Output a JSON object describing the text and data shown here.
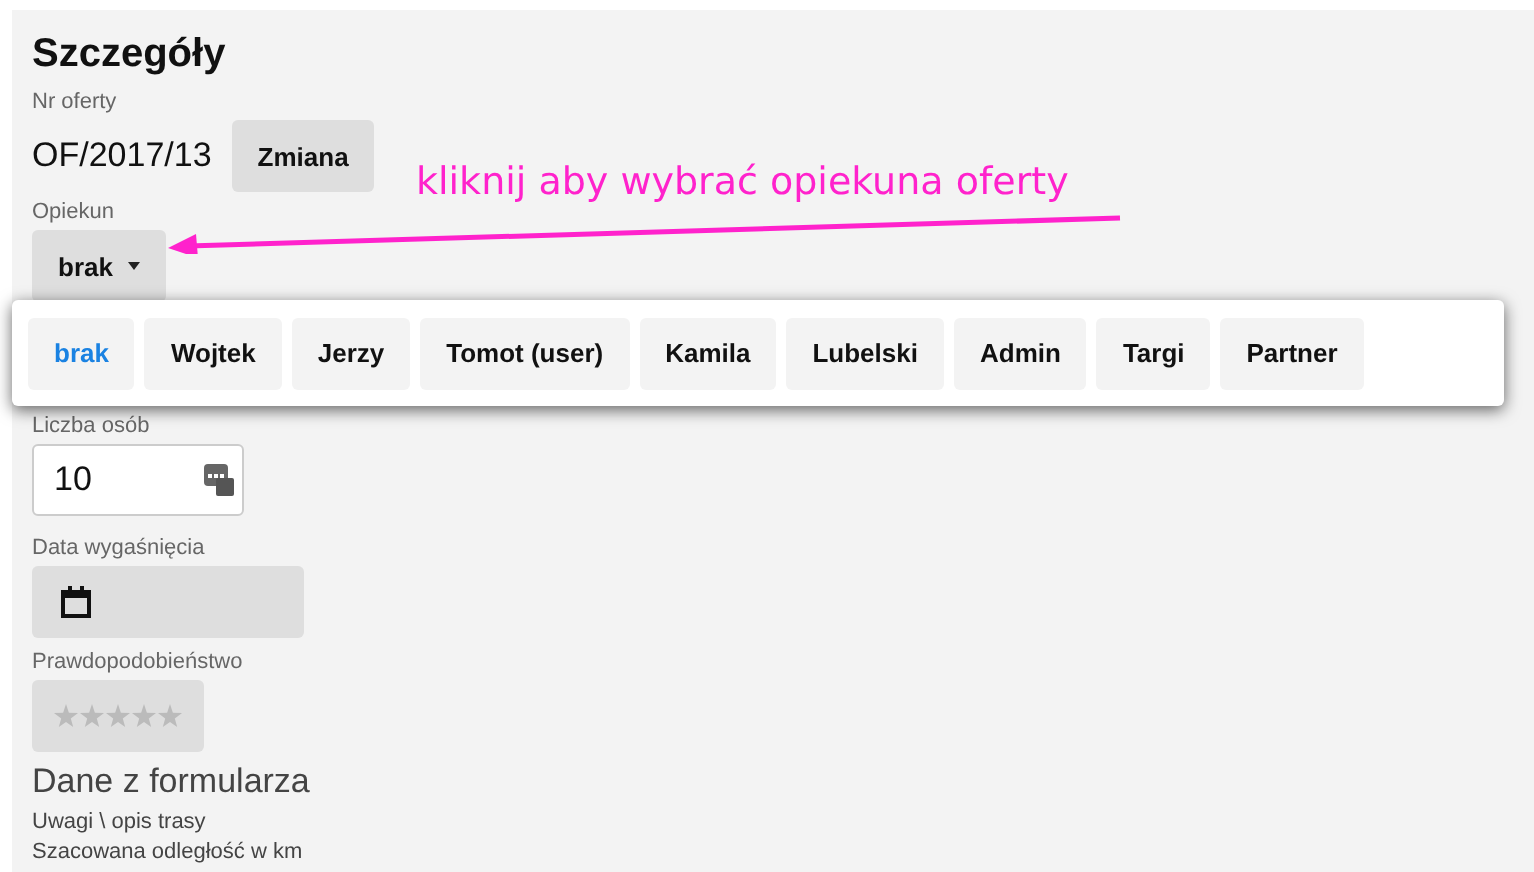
{
  "title": "Szczegóły",
  "offer": {
    "label": "Nr oferty",
    "number": "OF/2017/13",
    "button": "Zmiana"
  },
  "owner": {
    "label": "Opiekun",
    "value": "brak",
    "annotation": "kliknij aby wybrać opiekuna oferty"
  },
  "owner_options": [
    {
      "label": "brak",
      "selected": true
    },
    {
      "label": "Wojtek",
      "selected": false
    },
    {
      "label": "Jerzy",
      "selected": false
    },
    {
      "label": "Tomot (user)",
      "selected": false
    },
    {
      "label": "Kamila",
      "selected": false
    },
    {
      "label": "Lubelski",
      "selected": false
    },
    {
      "label": "Admin",
      "selected": false
    },
    {
      "label": "Targi",
      "selected": false
    },
    {
      "label": "Partner",
      "selected": false
    }
  ],
  "people": {
    "label": "Liczba osób",
    "value": "10"
  },
  "expiry": {
    "label": "Data wygaśnięcia"
  },
  "probability": {
    "label": "Prawdopodobieństwo",
    "stars": 0
  },
  "form_data": {
    "title": "Dane z formularza",
    "lines": [
      "Uwagi \\ opis trasy",
      "Szacowana odległość w km"
    ]
  }
}
